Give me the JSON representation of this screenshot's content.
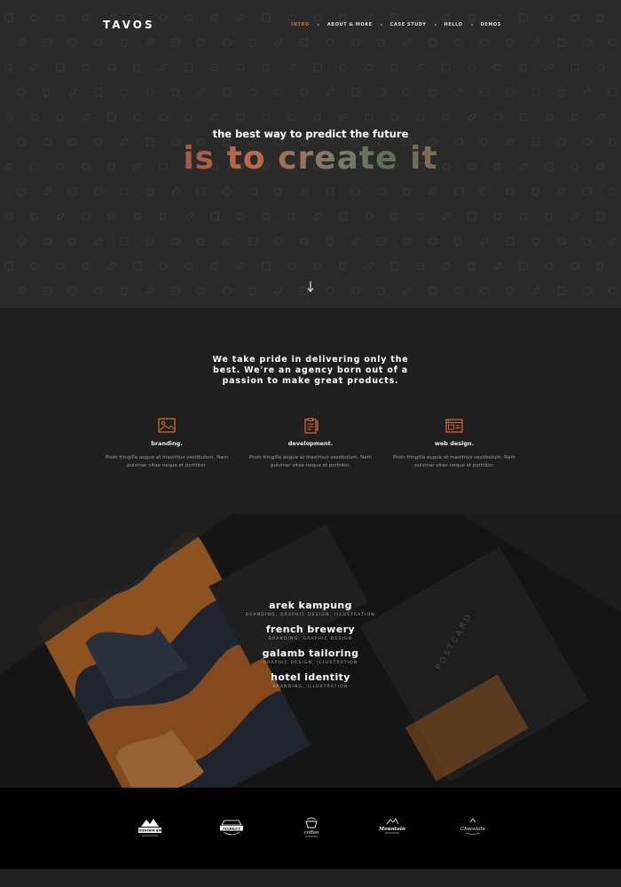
{
  "brand": {
    "logo": "TAVOS"
  },
  "nav": {
    "items": [
      "INTRO",
      "ABOUT & MORE",
      "CASE STUDY",
      "HELLO",
      "DEMOS"
    ],
    "active": "INTRO"
  },
  "hero": {
    "subtitle": "the best way to predict the future",
    "title": "is to create it",
    "scroll_icon": "arrow-down-icon"
  },
  "about": {
    "lead_line1": "We take pride in delivering only the",
    "lead_line2": "best. We're an agency born out of a",
    "lead_line3": "passion to make great products.",
    "services": [
      {
        "icon": "image-icon",
        "title": "branding.",
        "text_line1": "Proin fringilla augue at maximus vestibulum. Nam",
        "text_line2": "pulvinar vitae neque et porttitor."
      },
      {
        "icon": "clipboard-icon",
        "title": "development.",
        "text_line1": "Proin fringilla augue at maximus vestibulum. Nam",
        "text_line2": "pulvinar vitae neque et porttitor."
      },
      {
        "icon": "browser-window-icon",
        "title": "web design.",
        "text_line1": "Proin fringilla augue at maximus vestibulum. Nam",
        "text_line2": "pulvinar vitae neque et porttitor."
      }
    ]
  },
  "work": {
    "projects": [
      {
        "title": "arek kampung",
        "tags": "BRANDING, GRAPHIC DESIGN, ILLUSTRATION"
      },
      {
        "title": "french brewery",
        "tags": "BRANDING, GRAPHIC DESIGN"
      },
      {
        "title": "galamb tailoring",
        "tags": "GRAPHIC DESIGN, ILLUSTRATION"
      },
      {
        "title": "hotel identity",
        "tags": "BRANDING, ILLUSTRATION"
      }
    ]
  },
  "clients": {
    "logos": [
      {
        "name": "mountain-logo",
        "text": "MOUNTAIN BIKE"
      },
      {
        "name": "market-logo",
        "text": "MARKET"
      },
      {
        "name": "coffee-logo",
        "text": "coffee"
      },
      {
        "name": "mountain-script-logo",
        "text": "Mountain"
      },
      {
        "name": "chocolate-logo",
        "text": "Chocolate"
      }
    ]
  },
  "colors": {
    "accent": "#e0702b",
    "dark": "#1f1f1f",
    "hero_bg": "#2a2a2a"
  }
}
